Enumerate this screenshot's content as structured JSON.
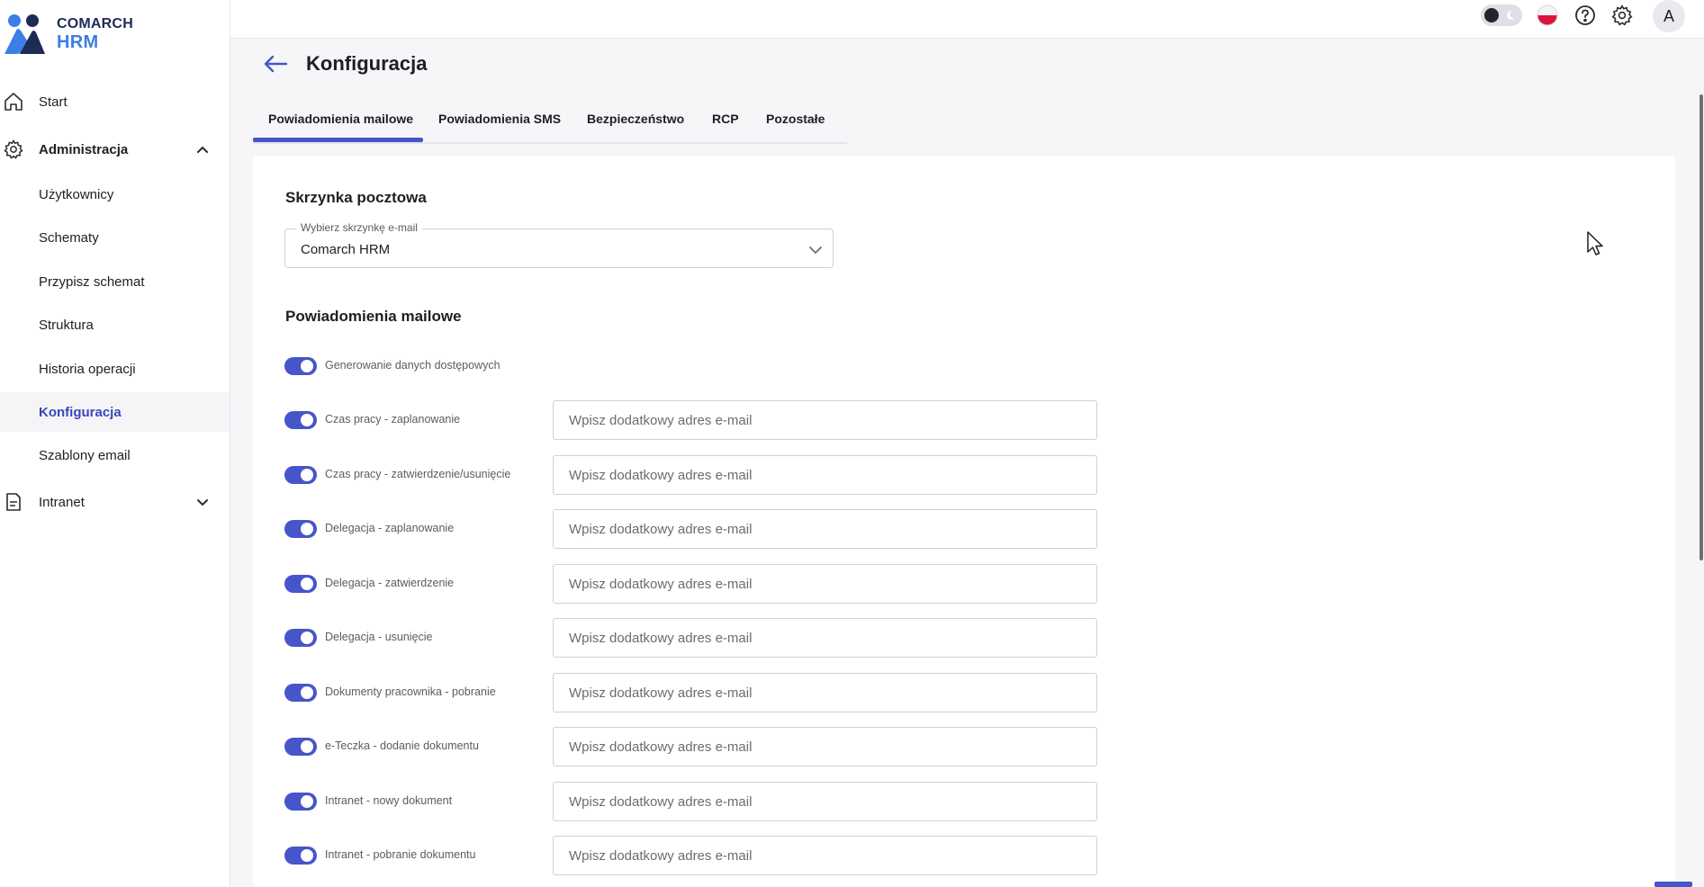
{
  "brand": {
    "line1": "COMARCH",
    "line2": "HRM"
  },
  "sidebar": {
    "items": [
      {
        "label": "Start",
        "icon": "home-icon"
      },
      {
        "label": "Administracja",
        "icon": "gear-icon",
        "expanded": true
      },
      {
        "label": "Intranet",
        "icon": "document-icon",
        "expanded": false
      }
    ],
    "admin_subitems": [
      {
        "label": "Użytkownicy"
      },
      {
        "label": "Schematy"
      },
      {
        "label": "Przypisz schemat"
      },
      {
        "label": "Struktura"
      },
      {
        "label": "Historia operacji"
      },
      {
        "label": "Konfiguracja",
        "active": true
      },
      {
        "label": "Szablony email"
      }
    ]
  },
  "topbar": {
    "avatar_initial": "A",
    "theme_mode": "dark"
  },
  "page": {
    "title": "Konfiguracja"
  },
  "tabs": [
    {
      "label": "Powiadomienia mailowe",
      "active": true
    },
    {
      "label": "Powiadomienia SMS"
    },
    {
      "label": "Bezpieczeństwo"
    },
    {
      "label": "RCP"
    },
    {
      "label": "Pozostałe"
    }
  ],
  "mailbox": {
    "section_title": "Skrzynka pocztowa",
    "select_label": "Wybierz skrzynkę e-mail",
    "select_value": "Comarch HRM"
  },
  "notifications": {
    "section_title": "Powiadomienia mailowe",
    "input_placeholder": "Wpisz dodatkowy adres e-mail",
    "rows": [
      {
        "label": "Generowanie danych dostępowych",
        "enabled": true,
        "has_input": false
      },
      {
        "label": "Czas pracy - zaplanowanie",
        "enabled": true,
        "has_input": true
      },
      {
        "label": "Czas pracy - zatwierdzenie/usunięcie",
        "enabled": true,
        "has_input": true
      },
      {
        "label": "Delegacja - zaplanowanie",
        "enabled": true,
        "has_input": true
      },
      {
        "label": "Delegacja - zatwierdzenie",
        "enabled": true,
        "has_input": true
      },
      {
        "label": "Delegacja - usunięcie",
        "enabled": true,
        "has_input": true
      },
      {
        "label": "Dokumenty pracownika - pobranie",
        "enabled": true,
        "has_input": true
      },
      {
        "label": "e-Teczka - dodanie dokumentu",
        "enabled": true,
        "has_input": true
      },
      {
        "label": "Intranet - nowy dokument",
        "enabled": true,
        "has_input": true
      },
      {
        "label": "Intranet - pobranie dokumentu",
        "enabled": true,
        "has_input": true
      }
    ]
  },
  "colors": {
    "accent": "#4655c9",
    "active_nav": "#3a47b8",
    "brand_dark": "#1d2b57",
    "brand_light": "#3c7ee6",
    "flag_red": "#dc143c"
  }
}
